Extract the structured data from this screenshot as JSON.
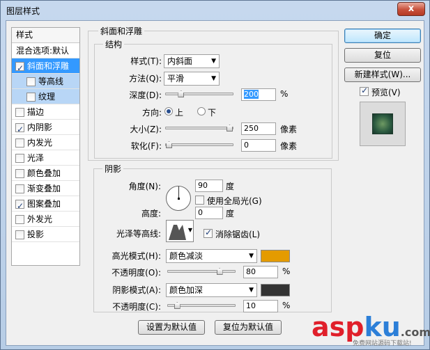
{
  "window": {
    "title": "图层样式",
    "close_label": "x"
  },
  "styles_panel": {
    "header": "样式",
    "items": [
      {
        "label": "混合选项:默认",
        "checkbox": false,
        "checked": false,
        "state": "plain"
      },
      {
        "label": "斜面和浮雕",
        "checkbox": true,
        "checked": true,
        "state": "selected"
      },
      {
        "label": "等高线",
        "checkbox": true,
        "checked": false,
        "state": "sub"
      },
      {
        "label": "纹理",
        "checkbox": true,
        "checked": false,
        "state": "sub"
      },
      {
        "label": "描边",
        "checkbox": true,
        "checked": false,
        "state": "normal"
      },
      {
        "label": "内阴影",
        "checkbox": true,
        "checked": true,
        "state": "normal"
      },
      {
        "label": "内发光",
        "checkbox": true,
        "checked": false,
        "state": "normal"
      },
      {
        "label": "光泽",
        "checkbox": true,
        "checked": false,
        "state": "normal"
      },
      {
        "label": "颜色叠加",
        "checkbox": true,
        "checked": false,
        "state": "normal"
      },
      {
        "label": "渐变叠加",
        "checkbox": true,
        "checked": false,
        "state": "normal"
      },
      {
        "label": "图案叠加",
        "checkbox": true,
        "checked": true,
        "state": "normal"
      },
      {
        "label": "外发光",
        "checkbox": true,
        "checked": false,
        "state": "normal"
      },
      {
        "label": "投影",
        "checkbox": true,
        "checked": false,
        "state": "normal"
      }
    ]
  },
  "bevel": {
    "group_title": "斜面和浮雕",
    "structure_title": "结构",
    "style_label": "样式(T):",
    "style_value": "内斜面",
    "technique_label": "方法(Q):",
    "technique_value": "平滑",
    "depth_label": "深度(D):",
    "depth_value": "200",
    "depth_unit": "%",
    "depth_slider": 0.2,
    "direction_label": "方向:",
    "direction_up": "上",
    "direction_down": "下",
    "direction_selected": "上",
    "size_label": "大小(Z):",
    "size_value": "250",
    "size_unit": "像素",
    "size_slider": 1.0,
    "soften_label": "软化(F):",
    "soften_value": "0",
    "soften_unit": "像素",
    "soften_slider": 0.0
  },
  "shading": {
    "title": "阴影",
    "angle_label": "角度(N):",
    "angle_value": "90",
    "angle_unit": "度",
    "global_light_label": "使用全局光(G)",
    "global_light_checked": false,
    "altitude_label": "高度:",
    "altitude_value": "0",
    "altitude_unit": "度",
    "gloss_label": "光泽等高线:",
    "antialias_label": "消除锯齿(L)",
    "antialias_checked": true,
    "highlight_mode_label": "高光模式(H):",
    "highlight_mode_value": "颜色减淡",
    "highlight_color": "#e49b00",
    "highlight_opacity_label": "不透明度(O):",
    "highlight_opacity_value": "80",
    "highlight_opacity_unit": "%",
    "highlight_opacity_slider": 0.8,
    "shadow_mode_label": "阴影模式(A):",
    "shadow_mode_value": "颜色加深",
    "shadow_color": "#333333",
    "shadow_opacity_label": "不透明度(C):",
    "shadow_opacity_value": "10",
    "shadow_opacity_unit": "%",
    "shadow_opacity_slider": 0.1
  },
  "footer": {
    "make_default": "设置为默认值",
    "reset_default": "复位为默认值"
  },
  "right": {
    "ok": "确定",
    "reset": "复位",
    "new_style": "新建样式(W)...",
    "preview_label": "预览(V)",
    "preview_checked": true
  },
  "watermark": {
    "brand_asp": "asp",
    "brand_ku": "ku",
    "brand_tld": ".com",
    "tagline": "免费网站源码下载站!"
  }
}
